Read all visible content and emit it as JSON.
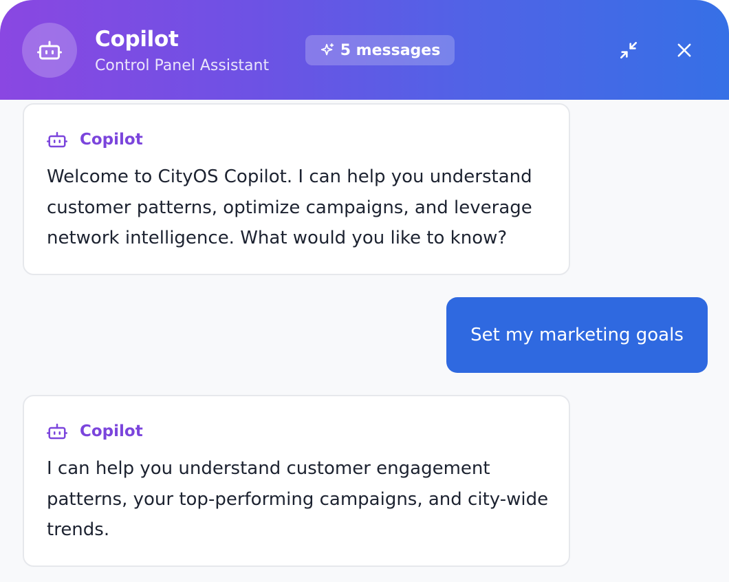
{
  "header": {
    "title": "Copilot",
    "subtitle": "Control Panel Assistant",
    "badge_label": "5 messages",
    "avatar_icon": "robot-icon",
    "badge_icon": "sparkles-icon",
    "minimize_icon": "minimize-icon",
    "close_icon": "close-icon",
    "gradient_start": "#8a47e2",
    "gradient_end": "#3670e6"
  },
  "messages": [
    {
      "role": "assistant",
      "sender": "Copilot",
      "icon": "robot-icon",
      "text": "Welcome to CityOS Copilot. I can help you understand customer patterns, optimize campaigns, and leverage network intelligence. What would you like to know?"
    },
    {
      "role": "user",
      "text": "Set my marketing goals"
    },
    {
      "role": "assistant",
      "sender": "Copilot",
      "icon": "robot-icon",
      "text": "I can help you understand customer engagement patterns, your top-performing campaigns, and city-wide trends."
    }
  ],
  "colors": {
    "accent_purple": "#7b45dc",
    "user_bubble": "#2f69e0",
    "panel_background": "#f8f9fb"
  }
}
